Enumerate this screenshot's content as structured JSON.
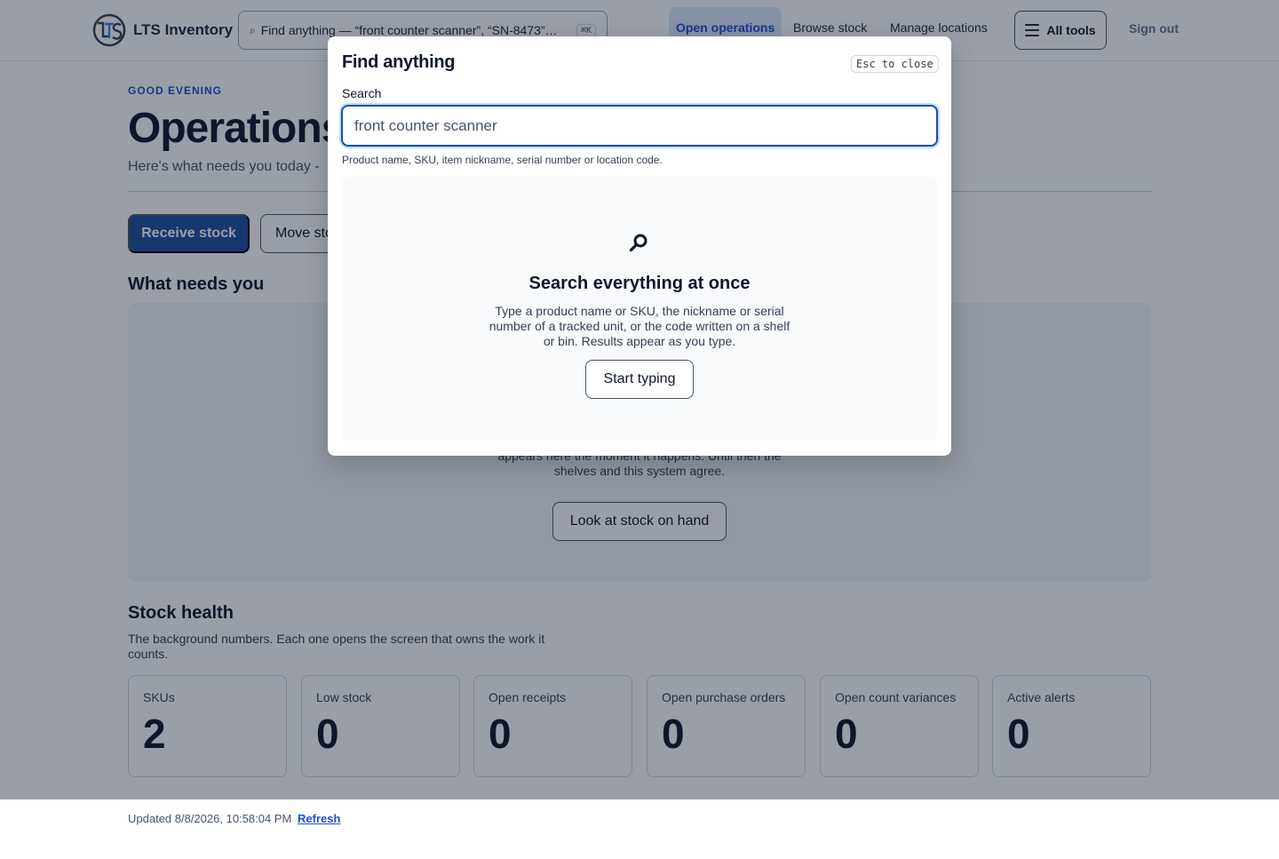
{
  "header": {
    "brand_name": "LTS Inventory",
    "search_placeholder": "Find anything — “front counter scanner”, “SN-8473”…",
    "search_shortcut": "⌘K",
    "nav": {
      "open_operations": "Open operations",
      "browse_stock": "Browse stock",
      "manage_locations": "Manage locations"
    },
    "all_tools_label": "All tools",
    "sign_out_label": "Sign out"
  },
  "main": {
    "greeting": "GOOD EVENING",
    "title": "Operations",
    "subtitle": "Here's what needs you today -",
    "receive_label": "Receive stock",
    "move_label": "Move stock",
    "needs": {
      "heading": "What needs you",
      "description": "appears here the moment it happens. Until then the shelves and this system agree.",
      "button_label": "Look at stock on hand"
    },
    "health": {
      "heading": "Stock health",
      "description": "The background numbers. Each one opens the screen that owns the work it counts.",
      "stats": [
        {
          "label": "SKUs",
          "value": "2"
        },
        {
          "label": "Low stock",
          "value": "0"
        },
        {
          "label": "Open receipts",
          "value": "0"
        },
        {
          "label": "Open purchase orders",
          "value": "0"
        },
        {
          "label": "Open count variances",
          "value": "0"
        },
        {
          "label": "Active alerts",
          "value": "0"
        }
      ]
    }
  },
  "footer": {
    "updated": "Updated 8/8/2026, 10:58:04 PM",
    "refresh_label": "Refresh"
  },
  "modal": {
    "title": "Find anything",
    "esc_label": "Esc to close",
    "field_label": "Search",
    "placeholder": "front counter scanner",
    "hint": "Product name, SKU, item nickname, serial number or location code.",
    "empty": {
      "icon": "search-icon",
      "title": "Search everything at once",
      "description": "Type a product name or SKU, the nickname or serial number of a tracked unit, or the code written on a shelf or bin. Results appear as you type.",
      "button_label": "Start typing"
    }
  },
  "colors": {
    "accent": "#1e4fa0",
    "link": "#1d4ed8",
    "overlay": "rgba(15,23,42,0.42)"
  }
}
